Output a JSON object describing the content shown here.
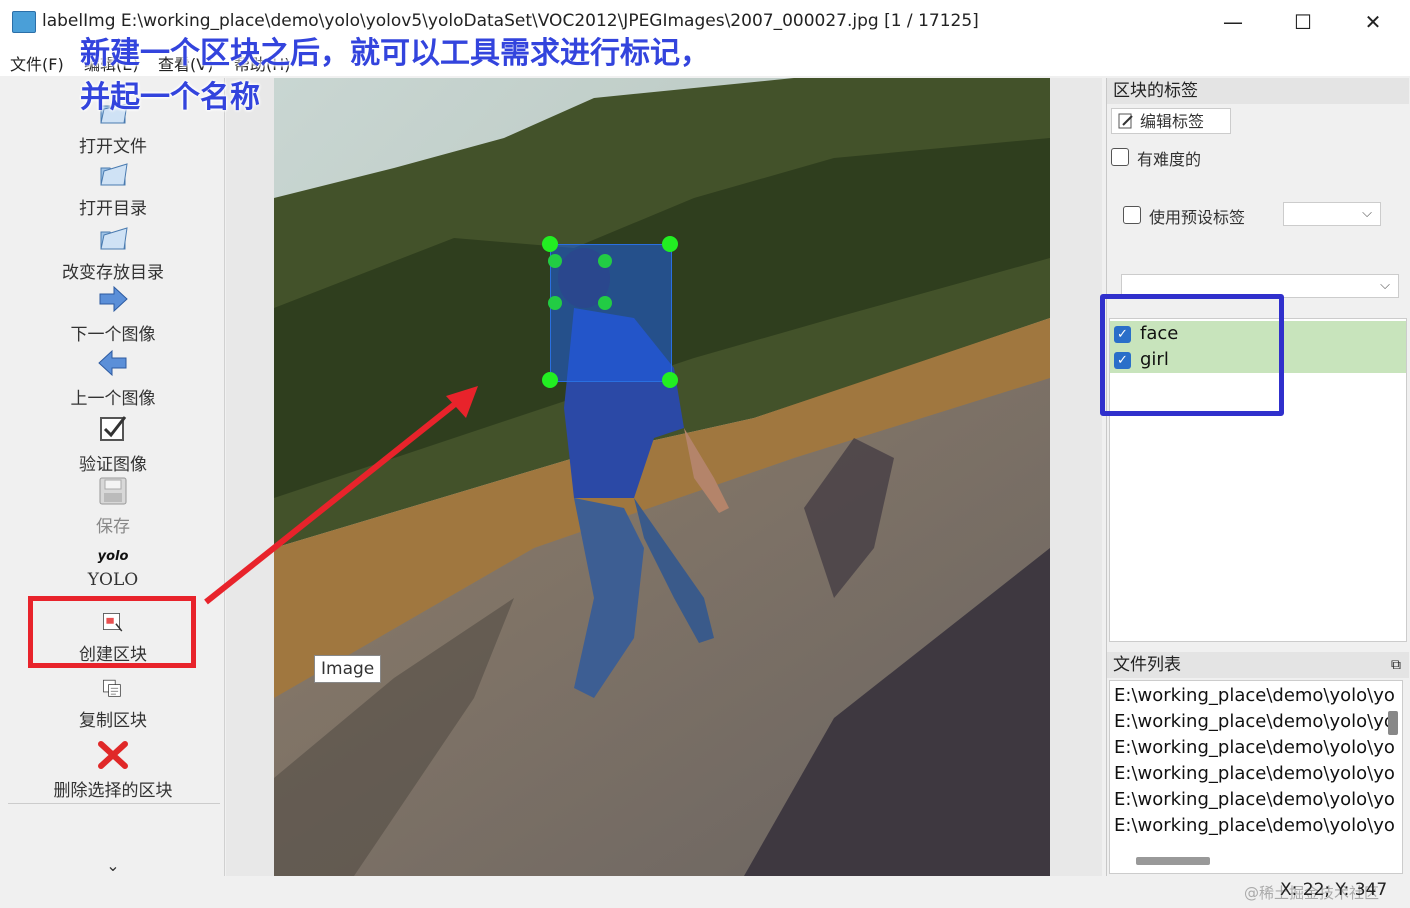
{
  "window": {
    "title": "labelImg E:\\working_place\\demo\\yolo\\yolov5\\yoloDataSet\\VOC2012\\JPEGImages\\2007_000027.jpg [1 / 17125]",
    "minimize": "—",
    "maximize": "☐",
    "close": "✕"
  },
  "menu": [
    "文件(F)",
    "编辑(E)",
    "查看(V)",
    "帮助(H)"
  ],
  "annotation_note": {
    "line1": "新建一个区块之后，就可以工具需求进行标记，",
    "line2": "并起一个名称"
  },
  "toolbar": {
    "items": [
      {
        "label": "打开文件",
        "icon": "open-file-icon"
      },
      {
        "label": "打开目录",
        "icon": "open-folder-icon"
      },
      {
        "label": "改变存放目录",
        "icon": "change-dir-icon"
      },
      {
        "label": "下一个图像",
        "icon": "next-arrow-icon"
      },
      {
        "label": "上一个图像",
        "icon": "prev-arrow-icon"
      },
      {
        "label": "验证图像",
        "icon": "verify-check-icon"
      },
      {
        "label": "保存",
        "icon": "save-icon"
      },
      {
        "label": "YOLO",
        "icon": "yolo-format-icon",
        "icon_text": "yolo"
      },
      {
        "label": "创建区块",
        "icon": "create-box-icon"
      },
      {
        "label": "复制区块",
        "icon": "copy-box-icon"
      },
      {
        "label": "删除选择的区块",
        "icon": "delete-box-icon"
      }
    ],
    "more": "⌄"
  },
  "canvas": {
    "tooltip": "Image"
  },
  "labels_dock": {
    "title": "区块的标签",
    "edit_label_button": "编辑标签",
    "difficult_label": "有难度的",
    "use_default_label": "使用预设标签",
    "labels": [
      {
        "name": "face",
        "checked": true
      },
      {
        "name": "girl",
        "checked": true
      }
    ],
    "highlight_color": "#c8e4bc"
  },
  "file_dock": {
    "title": "文件列表",
    "files": [
      "E:\\working_place\\demo\\yolo\\yo",
      "E:\\working_place\\demo\\yolo\\yo",
      "E:\\working_place\\demo\\yolo\\yo",
      "E:\\working_place\\demo\\yolo\\yo",
      "E:\\working_place\\demo\\yolo\\yo",
      "E:\\working_place\\demo\\yolo\\yo"
    ]
  },
  "status": {
    "coords": "X: 22; Y: 347",
    "watermark": "@稀土掘金技术社区"
  },
  "colors": {
    "annotation_text": "#3344dd",
    "highlight_red": "#e8232b",
    "highlight_blue": "#3030cc",
    "bbox_fill": "#1e5ee6",
    "bbox_handle": "#22ee22"
  }
}
